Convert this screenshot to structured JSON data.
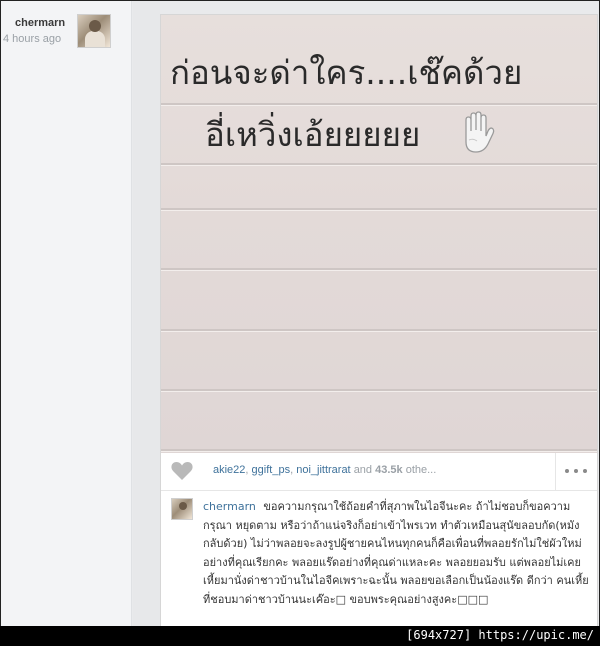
{
  "author": {
    "username": "chermarn",
    "time_ago": "4 hours ago"
  },
  "post": {
    "image_lines": [
      "ก่อนจะด่าใคร....เช๊คด้วย",
      "อี่เหวิ่งเอ้ยยยยย"
    ],
    "image_icon": "raised-hand-icon",
    "likes": {
      "users": [
        "akie22",
        "ggift_ps",
        "noi_jittrarat"
      ],
      "and": "and",
      "count": "43.5k",
      "others": "othe..."
    },
    "caption": {
      "username": "chermarn",
      "text": "ขอความกรุณาใช้ถ้อยคำที่สุภาพในไอจีนะคะ ถ้าไม่ชอบก็ขอความกรุณา หยุดตาม หรือว่าถ้าแน่จริงก็อย่าเข้าไพรเวท ทำตัวเหมือนสุนัขลอบกัด(หมังกลับด้วย) ไม่ว่าพลอยจะลงรูปผู้ชายคนไหนทุกคนก็คือเพื่อนที่พลอยรักไม่ใช่ผัวใหม่อย่างที่คุณเรียกคะ พลอยแร๊ดอย่างที่คุณด่าแหละคะ พลอยยอมรับ แต่พลอยไม่เคยเหี้ยมานั่งด่าชาวบ้านในไอจีคเพราะฉะนั้น พลอยขอเลือกเป็นน้องแร๊ด ดีกว่า คนเหี้ย ที่ชอบมาด่าชาวบ้านนะเค๊อะ□ ขอบพระคุณอย่างสูงคะ□□□"
    }
  },
  "watermark": "[694x727] https://upic.me/",
  "colors": {
    "link": "#3f729b",
    "muted": "#9aa0a6",
    "image_bg": "#e3dad8"
  }
}
